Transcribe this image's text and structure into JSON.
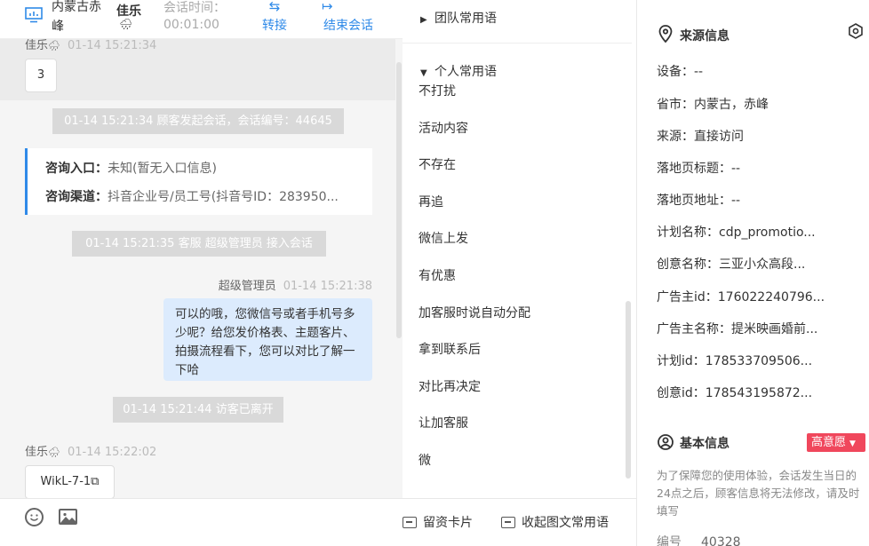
{
  "header": {
    "region": "内蒙古赤峰",
    "visitor_name": "佳乐",
    "weather_icon": "rain-cloud-icon",
    "duration_label": "会话时间：",
    "duration": "00:01:00",
    "transfer_label": "转接",
    "end_label": "结束会话",
    "accent": "#2f8ae8"
  },
  "chat": {
    "top_sender": "佳乐",
    "top_time": "01-14 15:21:34",
    "top_msg": "3",
    "sys1": "01-14 15:21:34 顾客发起会话，会话编号：44645",
    "info_entry_label": "咨询入口：",
    "info_entry_value": "未知(暂无入口信息)",
    "info_channel_label": "咨询渠道：",
    "info_channel_value": "抖音企业号/员工号(抖音号ID：283950...",
    "sys2": "01-14 15:21:35 客服 超级管理员 接入会话",
    "agent_name": "超级管理员",
    "agent_time": "01-14 15:21:38",
    "agent_msg": "可以的哦，您微信号或者手机号多少呢？给您发价格表、主题客片、拍摄流程看下，您可以对比了解一下哈",
    "sys3": "01-14 15:21:44 访客已离开",
    "bottom_sender": "佳乐",
    "bottom_time": "01-14 15:22:02",
    "bottom_msg": "WikL-7-1"
  },
  "phrases": {
    "team_group": "团队常用语",
    "personal_group": "个人常用语",
    "items": [
      "不打扰",
      "活动内容",
      "不存在",
      "再追",
      "微信上发",
      "有优惠",
      "加客服时说自动分配",
      "拿到联系后",
      "对比再决定",
      "让加客服",
      "微"
    ],
    "leave_card": "留资卡片",
    "collapse_rich": "收起图文常用语"
  },
  "info": {
    "source_title": "来源信息",
    "device": "设备：--",
    "province": "省市：内蒙古，赤峰",
    "source": "来源：直接访问",
    "landing_title": "落地页标题：--",
    "landing_url": "落地页地址：--",
    "plan_name": "计划名称：cdp_promotio...",
    "creative_name": "创意名称：三亚小众高段...",
    "advertiser_id": "广告主id：176022240796...",
    "advertiser_name": "广告主名称：提米映画婚前...",
    "plan_id": "计划id：178533709506...",
    "creative_id": "创意id：178543195872...",
    "basic_title": "基本信息",
    "intent": "高意愿",
    "intent_color": "#f0475c",
    "notice": "为了保障您的使用体验，会话发生当日的24点之后，顾客信息将无法修改，请及时填写",
    "number_label": "编号",
    "number_value": "40328"
  }
}
